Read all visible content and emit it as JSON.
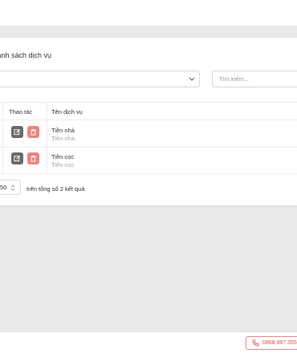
{
  "header": {},
  "card": {
    "title": "Danh sách dịch vụ",
    "filter_select_value": "",
    "search_placeholder": "Tìm kiếm..."
  },
  "table": {
    "columns": [
      "Thao tác",
      "Tên dịch vụ"
    ],
    "rows": [
      {
        "name": "Tiền nhà",
        "sub": "Tiền nhà"
      },
      {
        "name": "Tiền cọc",
        "sub": "Tiền cọc"
      }
    ]
  },
  "pagination": {
    "page_size": "50",
    "summary": "trên tổng số 2 kết quả"
  },
  "footer": {
    "phone": "0868.987.355"
  },
  "colors": {
    "edit_button": "#6b6b6b",
    "delete_button": "#ea8585",
    "phone_accent": "#d9534f"
  }
}
